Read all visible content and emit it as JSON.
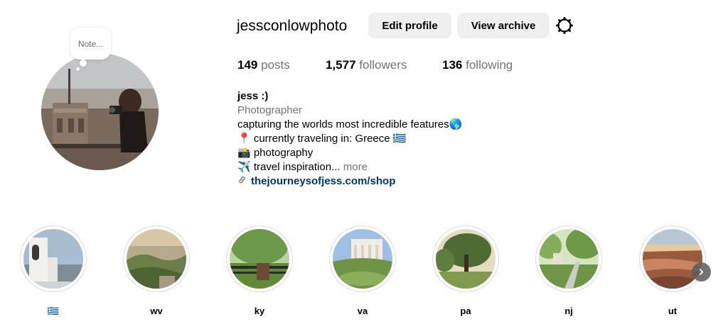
{
  "profile": {
    "username": "jessconlowphoto",
    "note_placeholder": "Note...",
    "edit_profile_label": "Edit profile",
    "view_archive_label": "View archive",
    "settings_icon": "gear-icon"
  },
  "stats": {
    "posts_count": "149",
    "posts_label": "posts",
    "followers_count": "1,577",
    "followers_label": "followers",
    "following_count": "136",
    "following_label": "following"
  },
  "bio": {
    "name": "jess :)",
    "category": "Photographer",
    "line1": "capturing the worlds most incredible features🌎",
    "line2": "📍 currently traveling in: Greece 🇬🇷",
    "line3": "📸 photography",
    "line4": "✈️ travel inspiration...",
    "more_label": "more",
    "link_text": "thejourneysofjess.com/shop",
    "link_icon": "link-icon"
  },
  "highlights": [
    {
      "label": "🇬🇷"
    },
    {
      "label": "wv"
    },
    {
      "label": "ky"
    },
    {
      "label": "va"
    },
    {
      "label": "pa"
    },
    {
      "label": "nj"
    },
    {
      "label": "ut"
    }
  ],
  "colors": {
    "link": "#00376b",
    "secondary_text": "#737373",
    "button_bg": "#efefef",
    "ring_border": "#dbdbdb"
  },
  "icons": {
    "next": "chevron-right-icon"
  }
}
